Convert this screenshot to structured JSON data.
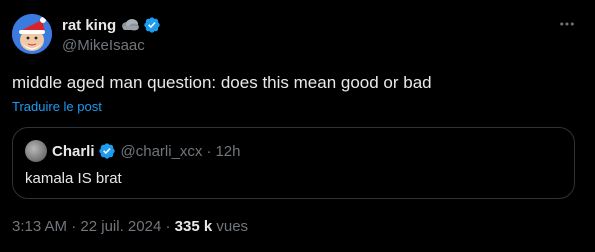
{
  "author": {
    "display_name": "rat king",
    "handle": "@MikeIsaac",
    "name_emoji": "rain-cloud-emoji",
    "verified_icon": "verified-badge-icon",
    "avatar_icon": "santa-avatar-icon"
  },
  "tweet": {
    "text": "middle aged man question: does this mean good or bad",
    "translate_link": "Traduire le post",
    "more_icon": "more-horizontal-icon"
  },
  "quote": {
    "display_name": "Charli",
    "handle": "@charli_xcx",
    "separator": "·",
    "time": "12h",
    "text": "kamala IS brat"
  },
  "meta": {
    "time": "3:13 AM",
    "separator1": " · ",
    "date": "22 juil. 2024",
    "separator2": " · ",
    "views_count": "335 k",
    "views_label": " vues"
  },
  "colors": {
    "background": "#000000",
    "text_primary": "#e7e9ea",
    "text_secondary": "#71767b",
    "link": "#1d9bf0",
    "verified": "#1d9bf0",
    "border": "#2f3336"
  }
}
